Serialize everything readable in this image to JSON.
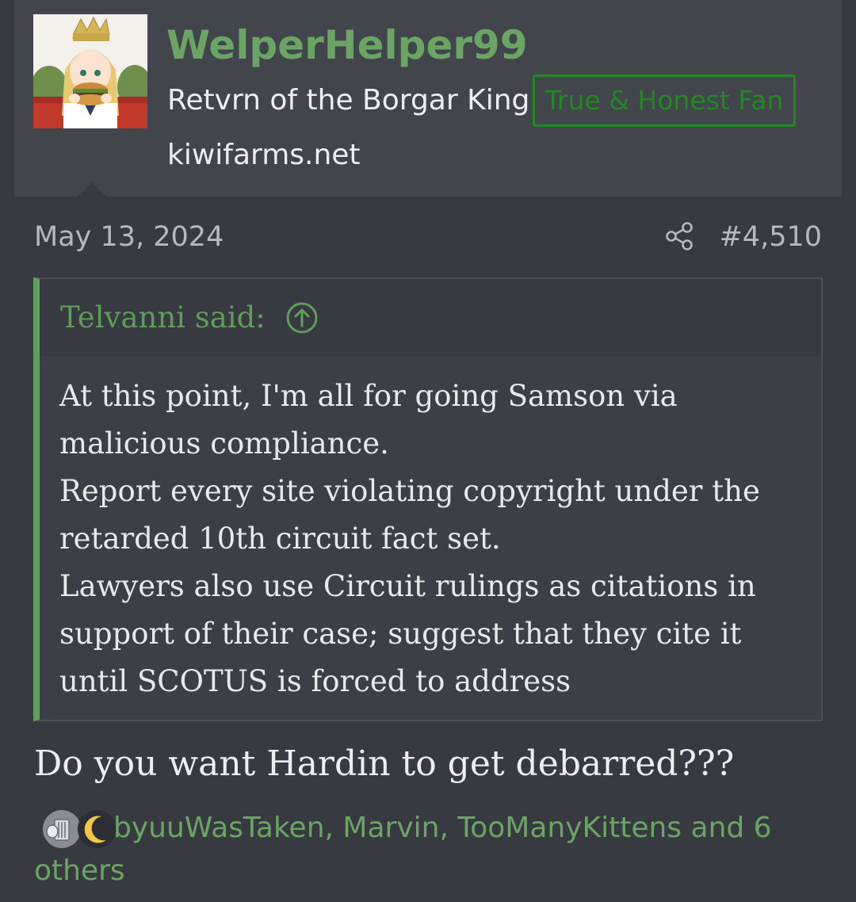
{
  "user": {
    "name": "WelperHelper99",
    "title": "Retvrn of the Borgar King",
    "badge": "True & Honest Fan",
    "site": "kiwifarms.net",
    "avatar_icon": "anime-girl-burger-crown-avatar"
  },
  "post": {
    "date": "May 13, 2024",
    "number": "#4,510",
    "share_icon": "share-icon",
    "quote": {
      "author": "Telvanni said:",
      "jump_icon": "arrow-up-circle-icon",
      "lines": [
        "At this point, I'm all for going Samson via",
        "malicious compliance.",
        "Report every site violating copyright under the",
        "retarded 10th circuit fact set.",
        "Lawyers also use Circuit rulings as citations in",
        "support of their case; suggest that they cite it",
        "until SCOTUS is forced to address"
      ]
    },
    "body": "Do you want Hardin to get debarred???",
    "reactions": {
      "icons": [
        "trash-can-reaction-icon",
        "moon-reaction-icon"
      ],
      "text": "byuuWasTaken, Marvin, TooManyKittens and 6 others"
    }
  },
  "colors": {
    "accent_green": "#6aa564",
    "badge_green": "#1f8a1f",
    "background": "#373a40",
    "header_background": "#42454c"
  }
}
